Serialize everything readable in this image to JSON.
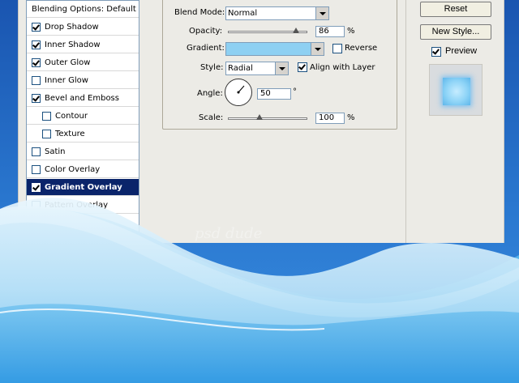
{
  "styles_list": {
    "items": [
      {
        "label": "Blending Options: Default",
        "checkbox": false,
        "checked": false,
        "indent": 0,
        "selected": false
      },
      {
        "label": "Drop Shadow",
        "checkbox": true,
        "checked": true,
        "indent": 0,
        "selected": false
      },
      {
        "label": "Inner Shadow",
        "checkbox": true,
        "checked": true,
        "indent": 0,
        "selected": false
      },
      {
        "label": "Outer Glow",
        "checkbox": true,
        "checked": true,
        "indent": 0,
        "selected": false
      },
      {
        "label": "Inner Glow",
        "checkbox": true,
        "checked": false,
        "indent": 0,
        "selected": false
      },
      {
        "label": "Bevel and Emboss",
        "checkbox": true,
        "checked": true,
        "indent": 0,
        "selected": false
      },
      {
        "label": "Contour",
        "checkbox": true,
        "checked": false,
        "indent": 1,
        "selected": false
      },
      {
        "label": "Texture",
        "checkbox": true,
        "checked": false,
        "indent": 1,
        "selected": false
      },
      {
        "label": "Satin",
        "checkbox": true,
        "checked": false,
        "indent": 0,
        "selected": false
      },
      {
        "label": "Color Overlay",
        "checkbox": true,
        "checked": false,
        "indent": 0,
        "selected": false
      },
      {
        "label": "Gradient Overlay",
        "checkbox": true,
        "checked": true,
        "indent": 0,
        "selected": true
      },
      {
        "label": "Pattern Overlay",
        "checkbox": true,
        "checked": false,
        "indent": 0,
        "selected": false
      }
    ]
  },
  "gradient_overlay": {
    "blend_mode_label": "Blend Mode:",
    "blend_mode_value": "Normal",
    "opacity_label": "Opacity:",
    "opacity_value": "86",
    "opacity_unit": "%",
    "opacity_fraction": 0.86,
    "gradient_label": "Gradient:",
    "gradient_color": "#8ed0f2",
    "reverse_label": "Reverse",
    "reverse_checked": false,
    "style_label": "Style:",
    "style_value": "Radial",
    "align_label": "Align with Layer",
    "align_checked": true,
    "angle_label": "Angle:",
    "angle_value": "50",
    "angle_unit": "°",
    "scale_label": "Scale:",
    "scale_value": "100",
    "scale_unit": "%",
    "scale_fraction": 0.4
  },
  "actions": {
    "reset_label": "Reset",
    "new_style_label": "New Style...",
    "preview_label": "Preview",
    "preview_checked": true
  },
  "watermark": "psd dude",
  "colors": {
    "selection": "#0a246a",
    "dialog": "#ecebe6",
    "background": "#1f5fb8"
  }
}
